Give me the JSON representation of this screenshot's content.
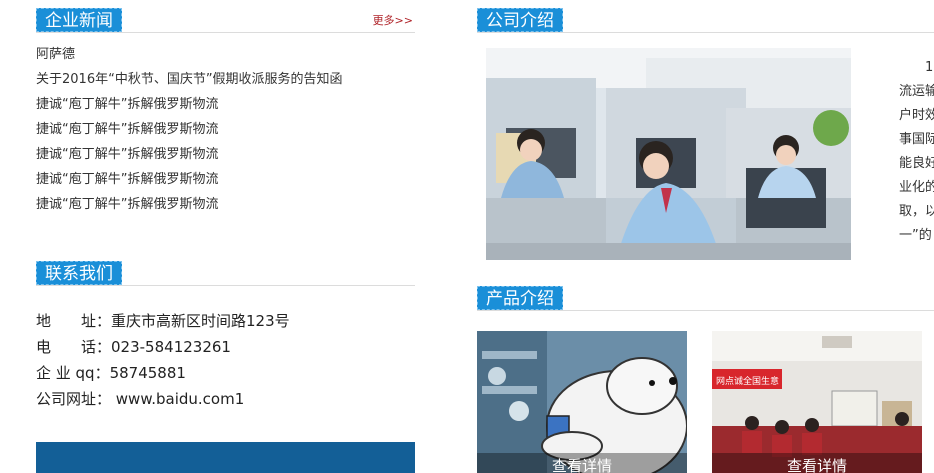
{
  "news": {
    "title": "企业新闻",
    "more": "更多>>",
    "items": [
      "阿萨德",
      "关于2016年“中秋节、国庆节”假期收派服务的告知函",
      "捷诚“庖丁解牛”拆解俄罗斯物流",
      "捷诚“庖丁解牛”拆解俄罗斯物流",
      "捷诚“庖丁解牛”拆解俄罗斯物流",
      "捷诚“庖丁解牛”拆解俄罗斯物流",
      "捷诚“庖丁解牛”拆解俄罗斯物流"
    ]
  },
  "contact": {
    "title": "联系我们",
    "rows": [
      {
        "label": "地　　址：",
        "value": "重庆市高新区时间路123号"
      },
      {
        "label": "电　　话：",
        "value": "023-584123261"
      },
      {
        "label": "企 业 qq：",
        "value": "58745881"
      },
      {
        "label": "公司网址：",
        "value": " www.baidu.com1"
      }
    ]
  },
  "about": {
    "title": "公司介绍",
    "text_lines": [
      "　　1",
      "流运输",
      "户时效",
      "事国际",
      "能良好",
      "业化的",
      "取，以",
      "一”的"
    ]
  },
  "products": {
    "title": "产品介绍",
    "items": [
      {
        "button": "查看详情"
      },
      {
        "button": "查看详情"
      }
    ],
    "banner_text": "网点诚全国生意"
  },
  "colors": {
    "accent": "#1a8fd8",
    "bar": "#135f97",
    "more": "#b0242a"
  }
}
